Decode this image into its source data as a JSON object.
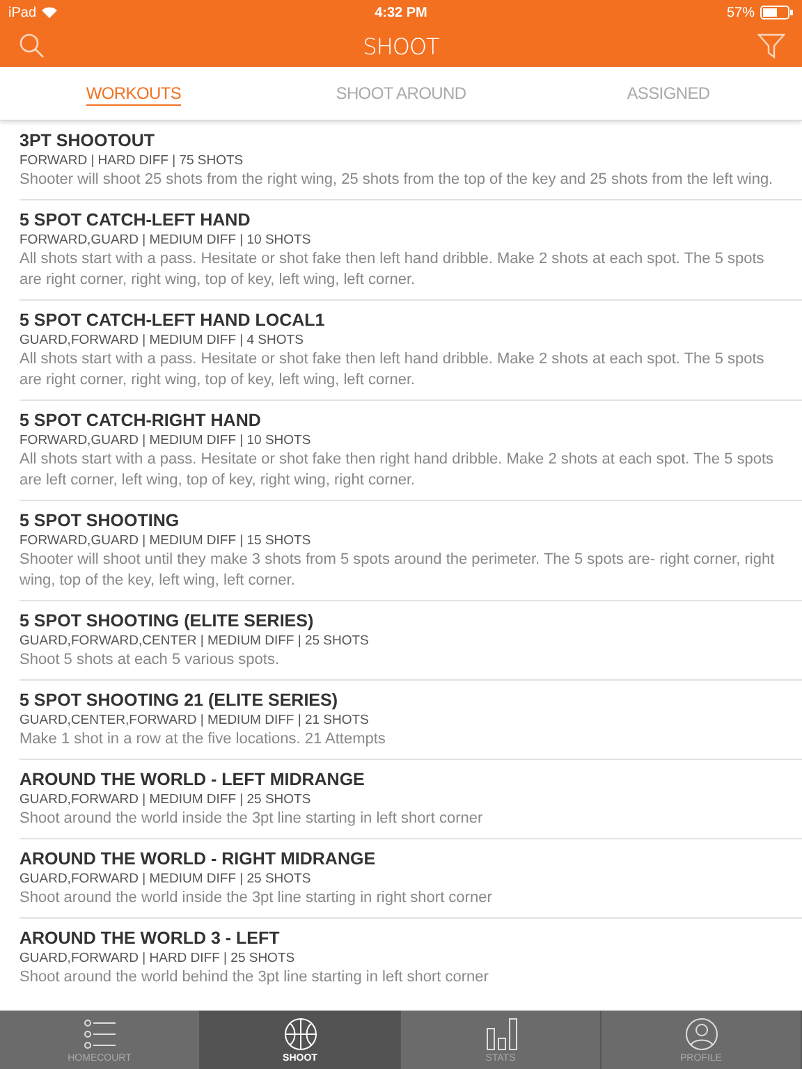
{
  "status_bar": {
    "device": "iPad",
    "time": "4:32 PM",
    "battery": "57%"
  },
  "nav_bar": {
    "title": "SHOOT"
  },
  "tabs": [
    {
      "label": "WORKOUTS",
      "selected": true
    },
    {
      "label": "SHOOT AROUND",
      "selected": false
    },
    {
      "label": "ASSIGNED",
      "selected": false
    }
  ],
  "workouts": [
    {
      "title": "3PT SHOOTOUT",
      "meta": "FORWARD | HARD DIFF | 75 SHOTS",
      "description": "Shooter will shoot 25 shots from the right wing, 25 shots from the top of the key and 25 shots from the left wing."
    },
    {
      "title": "5 SPOT CATCH-LEFT HAND",
      "meta": "FORWARD,GUARD | MEDIUM DIFF | 10 SHOTS",
      "description": "All shots start with a pass. Hesitate or shot fake then left hand dribble. Make 2 shots at each spot. The 5 spots are right corner, right wing, top of key, left wing, left corner."
    },
    {
      "title": "5 SPOT CATCH-LEFT HAND LOCAL1",
      "meta": "GUARD,FORWARD | MEDIUM DIFF | 4 SHOTS",
      "description": "All shots start with a pass. Hesitate or shot fake then left hand dribble. Make 2 shots at each spot. The 5 spots are right corner, right wing, top of key, left wing, left corner."
    },
    {
      "title": "5 SPOT CATCH-RIGHT HAND",
      "meta": "FORWARD,GUARD | MEDIUM DIFF | 10 SHOTS",
      "description": "All shots start with a pass. Hesitate or shot fake then right hand dribble. Make 2 shots at each spot. The 5 spots are left corner, left wing, top of key, right wing, right corner."
    },
    {
      "title": "5 SPOT SHOOTING",
      "meta": "FORWARD,GUARD | MEDIUM DIFF | 15 SHOTS",
      "description": "Shooter will shoot until they make 3 shots from 5 spots around the perimeter. The 5 spots are- right corner, right wing, top of the key, left wing, left corner."
    },
    {
      "title": "5 SPOT SHOOTING (ELITE SERIES)",
      "meta": "GUARD,FORWARD,CENTER | MEDIUM DIFF | 25 SHOTS",
      "description": "Shoot 5 shots at each 5 various spots."
    },
    {
      "title": "5 SPOT SHOOTING 21 (ELITE SERIES)",
      "meta": "GUARD,CENTER,FORWARD | MEDIUM DIFF | 21 SHOTS",
      "description": "Make 1 shot in a row at the five locations. 21 Attempts"
    },
    {
      "title": "AROUND THE WORLD - LEFT MIDRANGE",
      "meta": "GUARD,FORWARD | MEDIUM DIFF | 25 SHOTS",
      "description": "Shoot around the world inside the 3pt line starting in left short corner"
    },
    {
      "title": "AROUND THE WORLD - RIGHT MIDRANGE",
      "meta": "GUARD,FORWARD | MEDIUM DIFF | 25 SHOTS",
      "description": "Shoot around the world inside the 3pt line starting in right short corner"
    },
    {
      "title": "AROUND THE WORLD 3 - LEFT",
      "meta": "GUARD,FORWARD | HARD DIFF | 25 SHOTS",
      "description": "Shoot around the world behind the 3pt line starting in left short corner"
    }
  ],
  "tab_bar": [
    {
      "kind": "list",
      "label": "HOMECOURT",
      "selected": false
    },
    {
      "kind": "ball",
      "label": "SHOOT",
      "selected": true
    },
    {
      "kind": "bars",
      "label": "STATS",
      "selected": false
    },
    {
      "kind": "person",
      "label": "PROFILE",
      "selected": false
    }
  ]
}
